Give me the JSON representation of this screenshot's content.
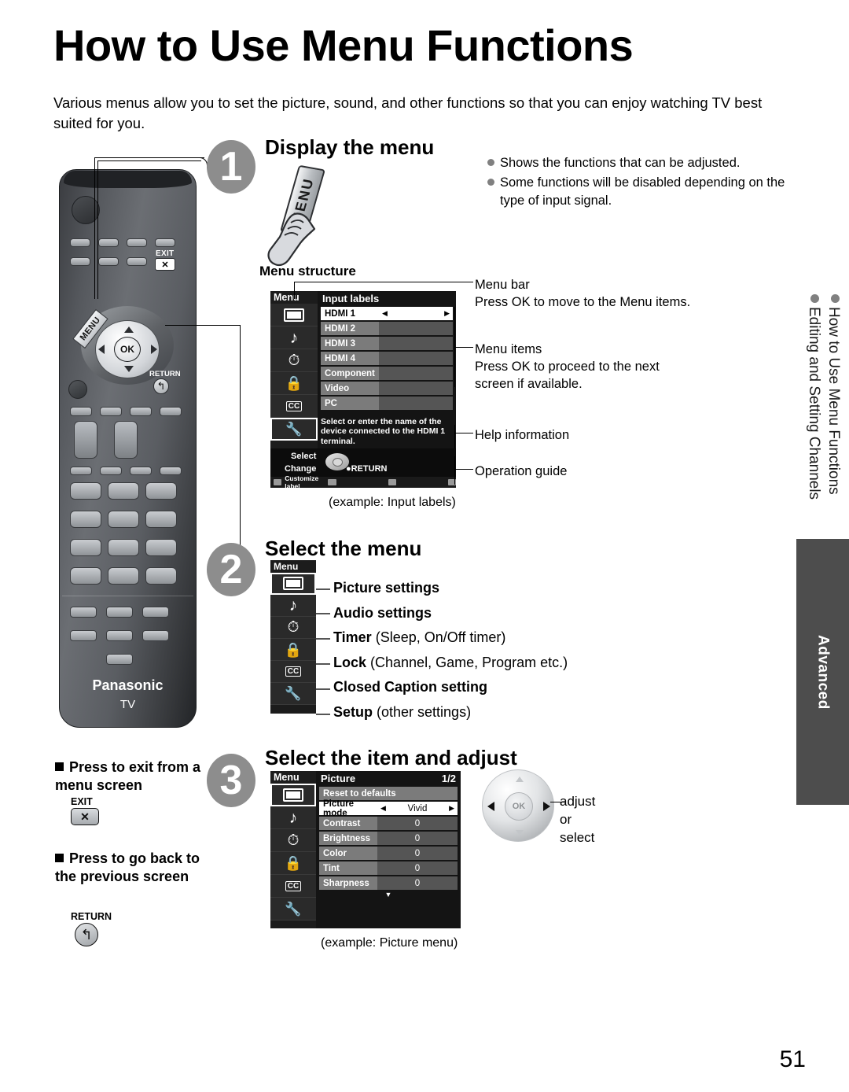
{
  "page": {
    "title": "How to Use Menu Functions",
    "intro": "Various menus allow you to set the picture, sound, and other functions so that you can enjoy watching TV best suited for you.",
    "number": "51"
  },
  "steps": [
    {
      "num": "1",
      "heading": "Display the menu"
    },
    {
      "num": "2",
      "heading": "Select the menu"
    },
    {
      "num": "3",
      "heading": "Select the item and adjust"
    }
  ],
  "step1": {
    "button_label": "MENU",
    "notes": [
      "Shows the functions that can be adjusted.",
      "Some functions will be disabled depending on the type of input signal."
    ],
    "menu_structure_label": "Menu structure",
    "caption": "(example: Input labels)",
    "osd": {
      "left_title": "Menu",
      "panel_title": "Input labels",
      "rows": [
        {
          "label": "HDMI 1",
          "value": "",
          "selected": true,
          "arrows": true
        },
        {
          "label": "HDMI 2",
          "value": "",
          "selected": false,
          "arrows": false
        },
        {
          "label": "HDMI 3",
          "value": "",
          "selected": false,
          "arrows": false
        },
        {
          "label": "HDMI 4",
          "value": "",
          "selected": false,
          "arrows": false
        },
        {
          "label": "Component",
          "value": "",
          "selected": false,
          "arrows": false
        },
        {
          "label": "Video",
          "value": "",
          "selected": false,
          "arrows": false
        },
        {
          "label": "PC",
          "value": "",
          "selected": false,
          "arrows": false
        }
      ],
      "help": "Select or enter the name of the device connected to the HDMI 1 terminal.",
      "guide": {
        "select": "Select",
        "change": "Change",
        "return": "RETURN",
        "customize": "Customize label"
      },
      "icons": [
        "picture-icon",
        "audio-note-icon",
        "timer-clock-icon",
        "lock-icon",
        "closed-caption-icon",
        "setup-wrench-icon"
      ]
    },
    "annotations": [
      {
        "title": "Menu bar",
        "body": "Press OK to move to the Menu items."
      },
      {
        "title": "Menu items",
        "body": "Press OK to proceed to the next screen if available."
      },
      {
        "title": "Help information",
        "body": ""
      },
      {
        "title": "Operation guide",
        "body": ""
      }
    ]
  },
  "step2": {
    "osd_left_title": "Menu",
    "items": [
      {
        "icon": "picture-icon",
        "bold": "Picture settings",
        "rest": ""
      },
      {
        "icon": "audio-note-icon",
        "bold": "Audio settings",
        "rest": ""
      },
      {
        "icon": "timer-clock-icon",
        "bold": "Timer",
        "rest": " (Sleep, On/Off timer)"
      },
      {
        "icon": "lock-icon",
        "bold": "Lock",
        "rest": " (Channel, Game, Program etc.)"
      },
      {
        "icon": "closed-caption-icon",
        "bold": "Closed Caption setting",
        "rest": ""
      },
      {
        "icon": "setup-wrench-icon",
        "bold": "Setup",
        "rest": " (other settings)"
      }
    ]
  },
  "step3": {
    "caption": "(example:  Picture menu)",
    "navpad_label": "adjust\nor\nselect",
    "navpad_ok": "OK",
    "osd": {
      "left_title": "Menu",
      "panel_title": "Picture",
      "page_indicator": "1/2",
      "rows": [
        {
          "label": "Reset to defaults",
          "value": "",
          "selected": false,
          "full": true
        },
        {
          "label": "Picture mode",
          "value": "Vivid",
          "selected": true,
          "arrows": true
        },
        {
          "label": "Contrast",
          "value": "0",
          "selected": false
        },
        {
          "label": "Brightness",
          "value": "0",
          "selected": false
        },
        {
          "label": "Color",
          "value": "0",
          "selected": false
        },
        {
          "label": "Tint",
          "value": "0",
          "selected": false
        },
        {
          "label": "Sharpness",
          "value": "0",
          "selected": false
        }
      ]
    }
  },
  "left_notes": {
    "exit": {
      "text": "Press to exit from a menu screen",
      "key_label": "EXIT",
      "key_glyph": "✕"
    },
    "return": {
      "text": "Press to go back to the previous screen",
      "key_label": "RETURN",
      "key_glyph": "↰"
    }
  },
  "sidebar": {
    "line1": "How to Use Menu Functions",
    "line2": "Editing and Setting Channels",
    "tab": "Advanced"
  },
  "remote": {
    "brand": "Panasonic",
    "model": "TV",
    "exit_label": "EXIT",
    "exit_glyph": "✕",
    "menu_label": "MENU",
    "return_label": "RETURN",
    "return_glyph": "↰",
    "ok_label": "OK"
  },
  "colors": {
    "step_circle": "#8d8d8d",
    "advanced_tab": "#4d4d4d",
    "osd_bg": "#141414",
    "osd_row_label": "#7b7b7b",
    "osd_row_value": "#555555"
  }
}
